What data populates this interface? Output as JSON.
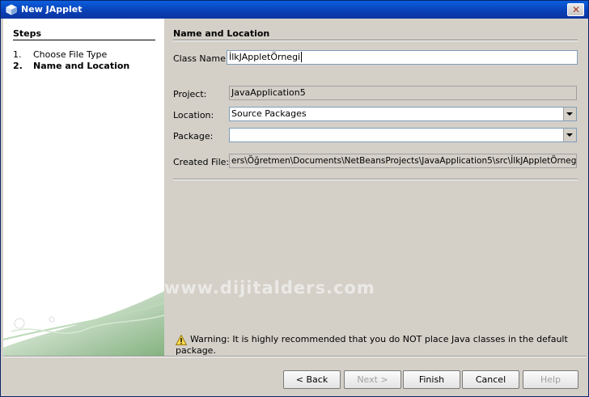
{
  "window": {
    "title": "New JApplet"
  },
  "steps": {
    "title": "Steps",
    "items": [
      {
        "num": "1.",
        "label": "Choose File Type"
      },
      {
        "num": "2.",
        "label": "Name and Location"
      }
    ]
  },
  "panel": {
    "title": "Name and Location",
    "class_name_label": "Class Name:",
    "class_name_value": "İlkJAppletÖrnegi",
    "project_label": "Project:",
    "project_value": "JavaApplication5",
    "location_label": "Location:",
    "location_value": "Source Packages",
    "package_label": "Package:",
    "package_value": "",
    "created_file_label": "Created File:",
    "created_file_value": "ers\\Öğretmen\\Documents\\NetBeansProjects\\JavaApplication5\\src\\İlkJAppletÖrnegi.java"
  },
  "watermark": "www.dijitalders.com",
  "warning": "Warning: It is highly recommended that you do NOT place Java classes in the default package.",
  "buttons": {
    "back": "< Back",
    "next": "Next >",
    "finish": "Finish",
    "cancel": "Cancel",
    "help": "Help"
  }
}
